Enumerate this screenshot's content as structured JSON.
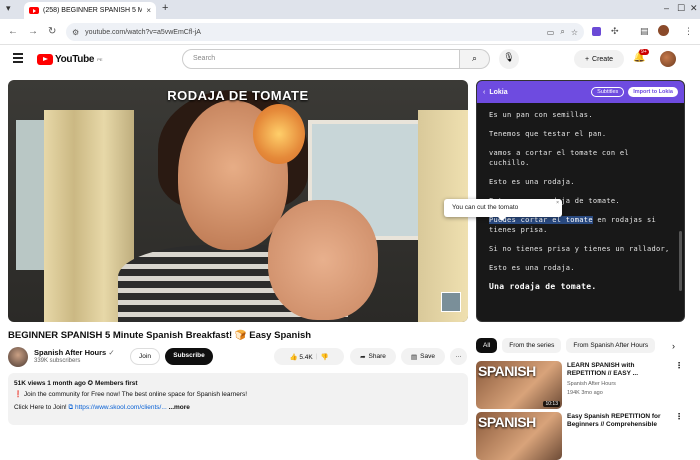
{
  "browser": {
    "tab_title": "(258) BEGINNER SPANISH 5 Mi",
    "tab_close": "×",
    "new_tab": "+",
    "url": "youtube.com/watch?v=a5vwEmCfl-jA"
  },
  "youtube": {
    "logo_text": "YouTube",
    "logo_region": "PE",
    "search_placeholder": "Search",
    "create_label": "Create",
    "notif_count": "9+"
  },
  "video": {
    "overlay_title": "RODAJA DE TOMATE",
    "title": "BEGINNER SPANISH 5 Minute Spanish Breakfast! 🍞 Easy Spanish"
  },
  "channel": {
    "name": "Spanish After Hours",
    "subscribers": "339K subscribers",
    "join_label": "Join",
    "subscribe_label": "Subscribe"
  },
  "actions": {
    "likes": "5.4K",
    "share": "Share",
    "save": "Save",
    "more": "···"
  },
  "description": {
    "meta": "51K views  1 month ago  ✪ Members first",
    "line1": "Join the community for Free now! The best online space for Spanish learners!",
    "line2_prefix": "Click Here to Join! ",
    "link": "https://www.skool.com/clients/...",
    "more": "...more"
  },
  "lokia": {
    "name": "Lokia",
    "back": "‹",
    "subtitles_tag": "Subtitles",
    "import_label": "Import to Lokia",
    "lines": [
      "Es un pan con semillas.",
      "Tenemos que testar el pan.",
      "vamos a cortar el tomate con el cuchillo.",
      "Esto es una rodaja.",
      "Esto es una rodaja de tomate."
    ],
    "hl_word": "Puedes cortar el tomate",
    "hl_rest": " en rodajas si tienes prisa.",
    "line7": "Si no tienes prisa y tienes un rallador,",
    "line8": "Esto es una rodaja.",
    "line9": "Una rodaja de tomate.",
    "tooltip": "You can cut the tomato"
  },
  "chips": [
    "All",
    "From the series",
    "From Spanish After Hours"
  ],
  "recs": [
    {
      "thumb_text": "SPANISH",
      "duration": "10:13",
      "title": "LEARN SPANISH with REPETITION // EASY ...",
      "channel": "Spanish After Hours",
      "stats": "194K  3mo ago"
    },
    {
      "thumb_text": "SPANISH",
      "duration": "",
      "title": "Easy Spanish REPETITION for Beginners // Comprehensible",
      "channel": "",
      "stats": ""
    }
  ]
}
